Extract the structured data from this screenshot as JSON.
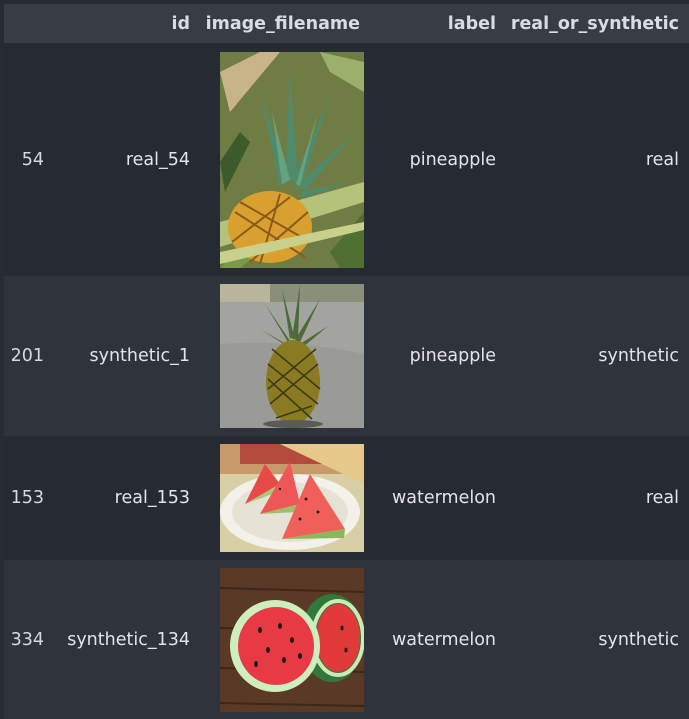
{
  "table": {
    "columns": [
      "id",
      "image_filename",
      "label",
      "real_or_synthetic"
    ],
    "rows": [
      {
        "index": "54",
        "id": "real_54",
        "label": "pineapple",
        "real_or_synthetic": "real",
        "image_icon": "pineapple-photo"
      },
      {
        "index": "201",
        "id": "synthetic_1",
        "label": "pineapple",
        "real_or_synthetic": "synthetic",
        "image_icon": "pineapple-photo"
      },
      {
        "index": "153",
        "id": "real_153",
        "label": "watermelon",
        "real_or_synthetic": "real",
        "image_icon": "watermelon-photo"
      },
      {
        "index": "334",
        "id": "synthetic_134",
        "label": "watermelon",
        "real_or_synthetic": "synthetic",
        "image_icon": "watermelon-photo"
      }
    ]
  },
  "colors": {
    "header_bg": "#383c45",
    "row_dark": "#262a33",
    "row_light": "#2f333c",
    "text": "#e2e4e8"
  }
}
